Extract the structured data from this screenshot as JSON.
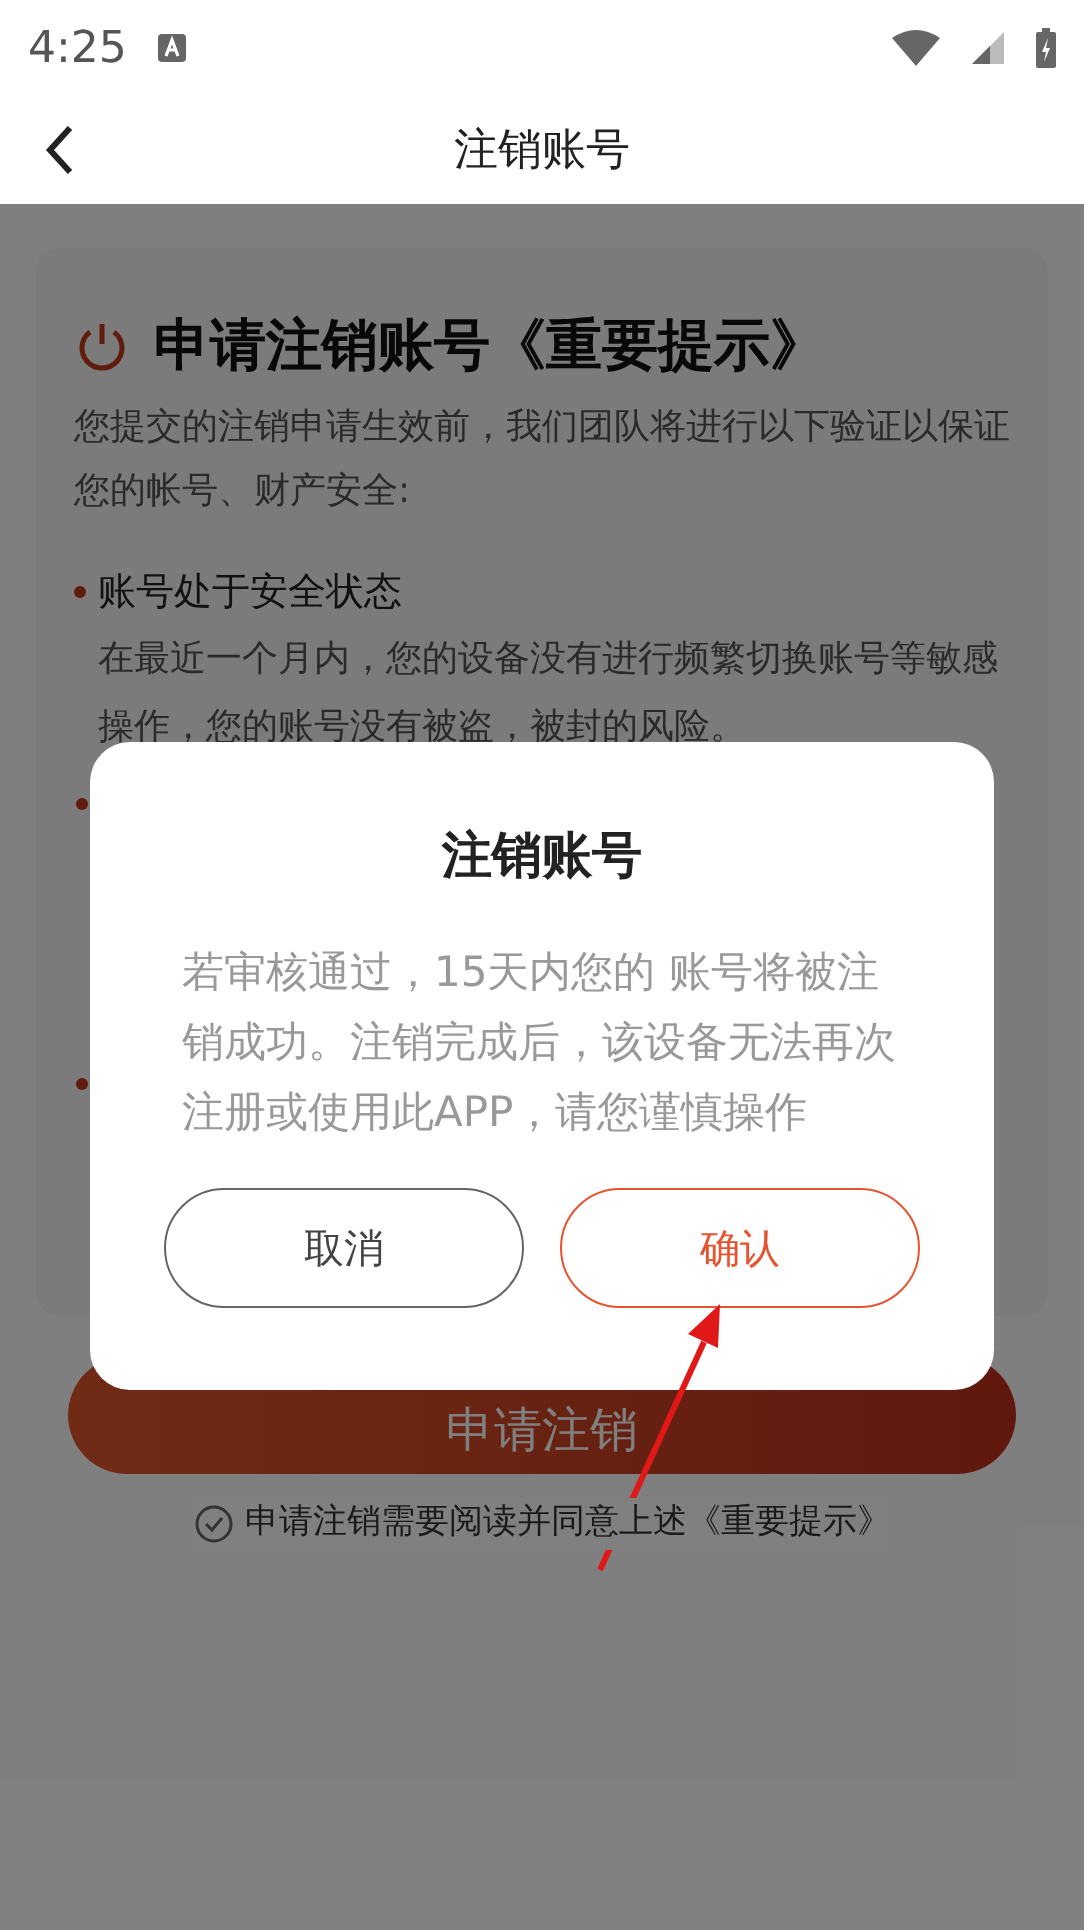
{
  "status_bar": {
    "time": "4:25"
  },
  "header": {
    "title": "注销账号"
  },
  "card": {
    "title": "申请注销账号《重要提示》",
    "intro": "您提交的注销申请生效前，我们团队将进行以下验证以保证您的帐号、财产安全:",
    "items": [
      {
        "title": "账号处于安全状态",
        "text": "在最近一个月内，您的设备没有进行频繁切换账号等敏感操作，您的账号没有被盗，被封的风险。"
      }
    ]
  },
  "submit_button": {
    "label": "申请注销"
  },
  "agreement": {
    "text": "申请注销需要阅读并同意上述《重要提示》",
    "checked": true
  },
  "dialog": {
    "title": "注销账号",
    "message": "若审核通过，15天内您的 账号将被注销成功。注销完成后，该设备无法再次注册或使用此APP，请您谨慎操作",
    "buttons": [
      {
        "label": "取消",
        "kind": "cancel"
      },
      {
        "label": "确认",
        "kind": "confirm"
      }
    ]
  }
}
